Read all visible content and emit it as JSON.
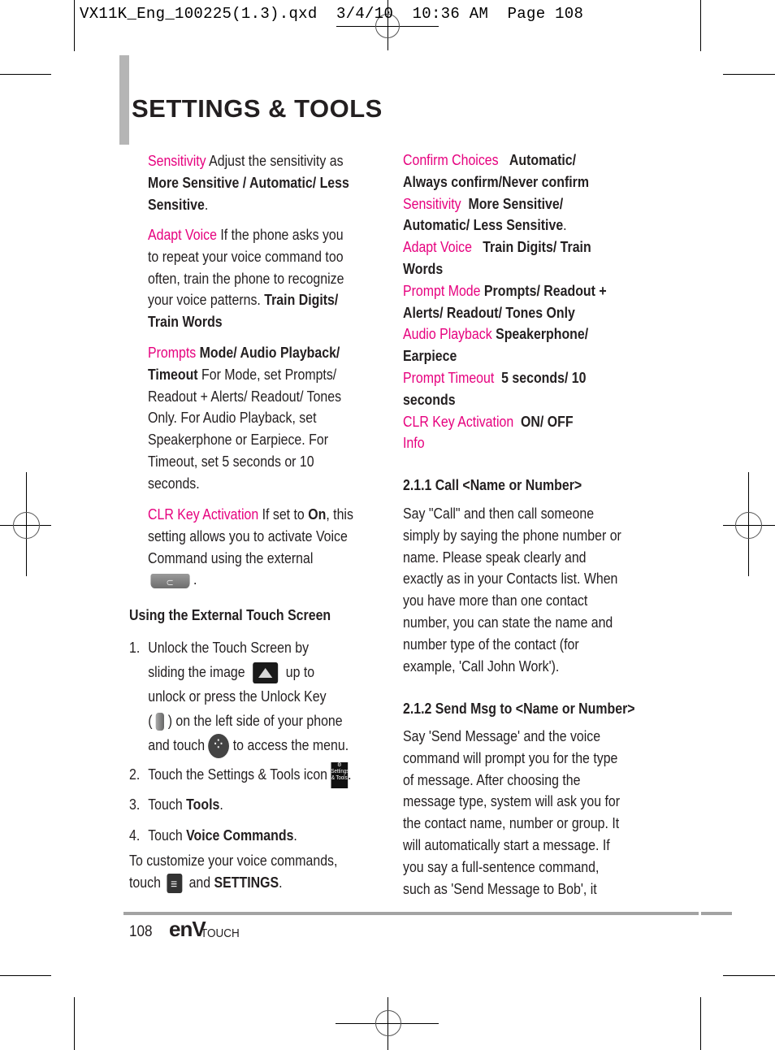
{
  "slug_line": "VX11K_Eng_100225(1.3).qxd  3/4/10  10:36 AM  Page 108",
  "page_title": "SETTINGS & TOOLS",
  "colors": {
    "accent": "#e6007e",
    "text": "#231f20",
    "title_bar": "#b5b5b5",
    "footer_rule": "#a3a3a3"
  },
  "left_column": {
    "sensitivity": {
      "term": "Sensitivity",
      "l1_rest": " Adjust the sensitivity as",
      "l2_bold": "More Sensitive / Automatic/ Less",
      "l3_bold": "Sensitive",
      "l3_tail": "."
    },
    "adapt_voice": {
      "term": "Adapt Voice",
      "l1_rest": " If the phone asks you",
      "l2": "to repeat your voice command too",
      "l3": "often, train the phone to recognize",
      "l4": "your voice patterns. ",
      "l4_bold": "Train Digits/",
      "l5_bold": "Train Words"
    },
    "prompts": {
      "term": "Prompts",
      "l1_bold": " Mode/ Audio Playback/",
      "l2_bold": "Timeout",
      "l2_rest": " For Mode, set Prompts/",
      "l3": "Readout + Alerts/ Readout/ Tones",
      "l4": "Only. For Audio Playback, set",
      "l5": "Speakerphone or Earpiece. For",
      "l6": "Timeout, set 5 seconds or 10",
      "l7": "seconds."
    },
    "clr_key": {
      "term": "CLR Key Activation",
      "l1_rest": " If set to ",
      "l1_bold": "On",
      "l1_tail": ", this",
      "l2": "setting allows you to activate Voice",
      "l3": "Command using the external",
      "l4_tail": "."
    },
    "external_heading": "Using the External Touch Screen",
    "steps": {
      "s1_num": "1.",
      "s1_l1": "Unlock the Touch Screen by",
      "s1_l2a": "sliding the image",
      "s1_l2b": "up to",
      "s1_l3": "unlock or press the Unlock Key",
      "s1_l4a": "(",
      "s1_l4b": ") on the left side of your phone",
      "s1_l5a": "and touch",
      "s1_l5b": "to access the menu.",
      "s2_num": "2.",
      "s2_text": "Touch the Settings & Tools icon",
      "s2_tail": ".",
      "s3_num": "3.",
      "s3_text": "Touch ",
      "s3_bold": "Tools",
      "s3_tail": ".",
      "s4_num": "4.",
      "s4_text": "Touch ",
      "s4_bold": "Voice Commands",
      "s4_tail": "."
    },
    "customize_l1": "To customize your voice commands,",
    "customize_l2a": "touch",
    "customize_l2b": "and ",
    "customize_l2_bold": "SETTINGS",
    "customize_l2_tail": "."
  },
  "right_column": {
    "options": [
      {
        "term": "Confirm Choices",
        "l1_bold": "Automatic/",
        "l2_bold": "Always confirm/Never confirm"
      },
      {
        "term": "Sensitivity",
        "l1_bold": "More Sensitive/",
        "l2_bold": "Automatic/ Less Sensitive",
        "l2_tail": "."
      },
      {
        "term": "Adapt Voice",
        "l1_bold": "Train Digits/ Train",
        "l2_bold": "Words"
      },
      {
        "term": "Prompt Mode",
        "l1_bold": "Prompts/ Readout +",
        "l2_bold": "Alerts/ Readout/ Tones Only"
      },
      {
        "term": "Audio Playback",
        "l1_bold": "Speakerphone/",
        "l2_bold": "Earpiece"
      },
      {
        "term": "Prompt Timeout",
        "l1_bold": "5 seconds/ 10",
        "l2_bold": "seconds"
      },
      {
        "term": "CLR Key Activation",
        "l1_bold": "ON/ OFF"
      },
      {
        "term": "Info"
      }
    ],
    "section_211": {
      "heading": "2.1.1 Call <Name or Number>",
      "lines": [
        "Say \"Call\" and then call someone",
        "simply by saying the phone number or",
        "name. Please speak clearly and",
        "exactly as in your Contacts list. When",
        "you have more than one contact",
        "number, you can state the name and",
        "number type of the contact (for",
        "example, 'Call John Work')."
      ]
    },
    "section_212": {
      "heading": "2.1.2 Send Msg to <Name or Number>",
      "lines": [
        "Say 'Send Message' and the voice",
        "command will prompt you for the type",
        "of message. After choosing the",
        "message type, system will ask you for",
        "the contact name, number or group. It",
        "will automatically start a message. If",
        "you say a full-sentence command,",
        "such as 'Send Message to Bob', it"
      ]
    }
  },
  "footer": {
    "page_number": "108",
    "brand_logo": "enV",
    "brand_sub": "TOUCH"
  },
  "icons": {
    "clr_key": "clr-key-icon",
    "unlock_image": "unlock-slider-icon",
    "unlock_key": "unlock-key-icon",
    "menu": "menu-icon",
    "settings_tools": "settings-tools-icon",
    "options": "options-menu-icon"
  }
}
